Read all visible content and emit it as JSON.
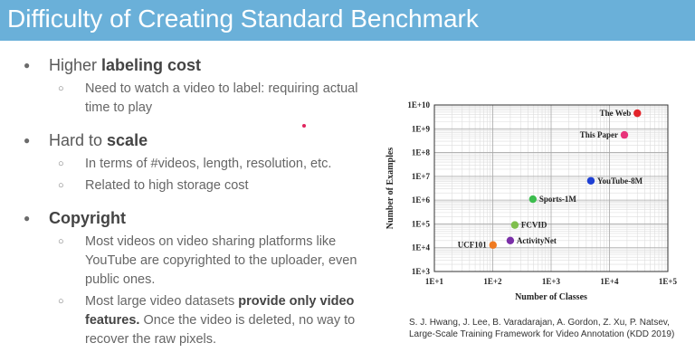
{
  "slide": {
    "title": "Difficulty of Creating Standard Benchmark",
    "bullets": [
      {
        "pre": "Higher ",
        "bold": "labeling cost",
        "post": "",
        "subs": [
          {
            "text": "Need to watch a video to label: requiring actual time to play"
          }
        ]
      },
      {
        "pre": "Hard to ",
        "bold": "scale",
        "post": "",
        "subs": [
          {
            "text": "In terms of #videos, length, resolution, etc."
          },
          {
            "text": "Related to high storage cost"
          }
        ]
      },
      {
        "pre": "",
        "bold": "Copyright",
        "post": "",
        "subs": [
          {
            "text": "Most videos on video sharing platforms like YouTube are copyrighted to the uploader, even public ones."
          },
          {
            "pre": "Most large video datasets ",
            "bold": "provide only video features.",
            "post": " Once the video is deleted, no way to recover the raw pixels."
          }
        ]
      }
    ],
    "caption_line1": "S. J. Hwang, J. Lee, B. Varadarajan, A. Gordon, Z. Xu, P. Natsev,",
    "caption_line2": "Large-Scale Training Framework for Video Annotation (KDD 2019)"
  },
  "chart_data": {
    "type": "scatter",
    "xlabel": "Number of Classes",
    "ylabel": "Number of Examples",
    "x_scale": "log",
    "y_scale": "log",
    "xlim": [
      10,
      100000
    ],
    "ylim": [
      1000,
      10000000000
    ],
    "x_ticks": [
      "1E+1",
      "1E+2",
      "1E+3",
      "1E+4",
      "1E+5"
    ],
    "y_ticks": [
      "1E+3",
      "1E+4",
      "1E+5",
      "1E+6",
      "1E+7",
      "1E+8",
      "1E+9",
      "1E+10"
    ],
    "grid": true,
    "points": [
      {
        "label": "The Web",
        "x": 30000,
        "y": 4500000000,
        "color": "#e3242b",
        "label_side": "left"
      },
      {
        "label": "This Paper",
        "x": 18000,
        "y": 550000000,
        "color": "#e8337a",
        "label_side": "left"
      },
      {
        "label": "YouTube-8M",
        "x": 4800,
        "y": 6500000,
        "color": "#1e3fd4",
        "label_side": "right"
      },
      {
        "label": "Sports-1M",
        "x": 487,
        "y": 1100000,
        "color": "#3cbd4e",
        "label_side": "right"
      },
      {
        "label": "FCVID",
        "x": 239,
        "y": 90000,
        "color": "#7fbf4d",
        "label_side": "right"
      },
      {
        "label": "ActivityNet",
        "x": 200,
        "y": 20000,
        "color": "#7a2fa8",
        "label_side": "right"
      },
      {
        "label": "UCF101",
        "x": 101,
        "y": 13000,
        "color": "#f07a20",
        "label_side": "left"
      }
    ]
  }
}
